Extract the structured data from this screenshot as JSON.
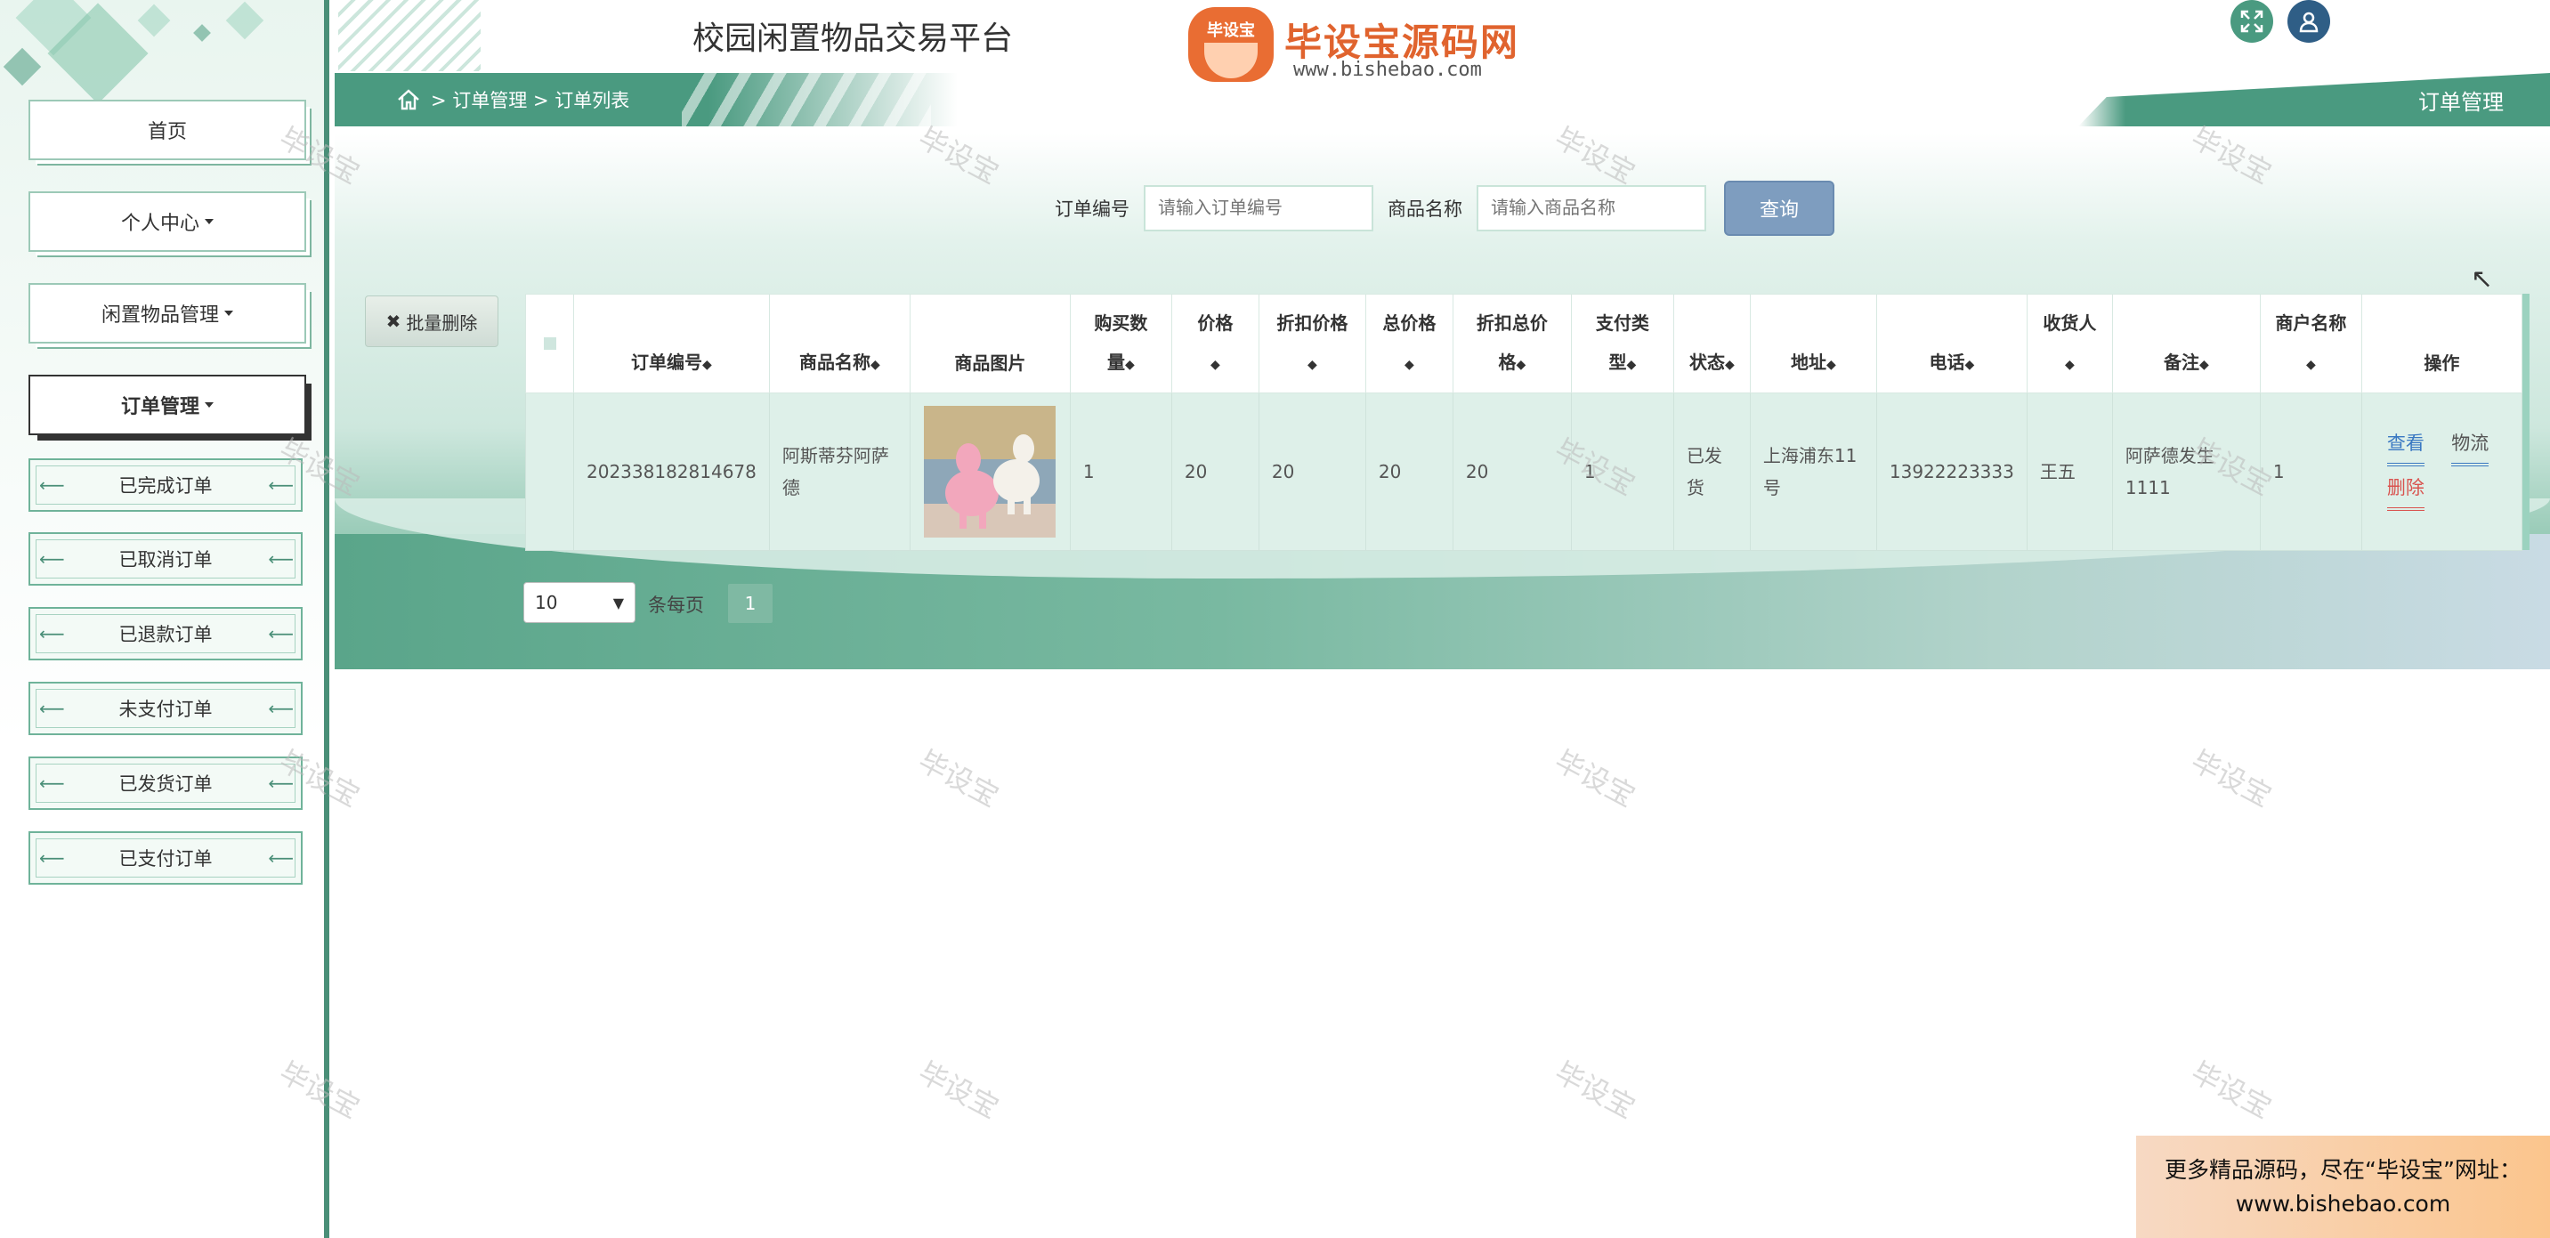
{
  "app": {
    "title": "校园闲置物品交易平台",
    "logo_main": "毕设宝源码网",
    "logo_badge": "毕设宝",
    "logo_url": "www.bishebao.com"
  },
  "header": {
    "fullscreen_icon": "expand-icon",
    "user_icon": "user-icon",
    "section_title": "订单管理"
  },
  "breadcrumb": {
    "home_icon": "home-icon",
    "text": "> 订单管理 > 订单列表"
  },
  "sidebar": {
    "items": [
      {
        "label": "首页"
      },
      {
        "label": "个人中心"
      },
      {
        "label": "闲置物品管理"
      },
      {
        "label": "订单管理"
      }
    ],
    "sub_items": [
      {
        "label": "已完成订单"
      },
      {
        "label": "已取消订单"
      },
      {
        "label": "已退款订单"
      },
      {
        "label": "未支付订单"
      },
      {
        "label": "已发货订单"
      },
      {
        "label": "已支付订单"
      }
    ]
  },
  "search": {
    "order_label": "订单编号",
    "order_placeholder": "请输入订单编号",
    "goods_label": "商品名称",
    "goods_placeholder": "请输入商品名称",
    "button": "查询"
  },
  "batch_delete": {
    "icon": "close-icon",
    "label": "批量删除"
  },
  "table": {
    "headers": {
      "order_no": "订单编号",
      "goods_name": "商品名称",
      "goods_img": "商品图片",
      "qty_1": "购买数",
      "qty_2": "量",
      "price": "价格",
      "discount_price": "折扣价格",
      "total": "总价格",
      "discount_total_1": "折扣总价",
      "discount_total_2": "格",
      "pay_type_1": "支付类",
      "pay_type_2": "型",
      "status": "状态",
      "address": "地址",
      "phone": "电话",
      "receiver": "收货人",
      "remark": "备注",
      "merchant": "商户名称",
      "ops": "操作"
    },
    "rows": [
      {
        "order_no": "202338182814678",
        "goods_name": "阿斯蒂芬阿萨德",
        "qty": "1",
        "price": "20",
        "discount_price": "20",
        "total": "20",
        "discount_total": "20",
        "pay_type": "1",
        "status": "已发货",
        "address": "上海浦东11号",
        "phone": "13922223333",
        "receiver": "王五",
        "remark": "阿萨德发生1111",
        "merchant": "1",
        "op_view": "查看",
        "op_logistics": "物流",
        "op_delete": "删除"
      }
    ]
  },
  "pagination": {
    "page_size": "10",
    "per_page_label": "条每页",
    "current_page": "1"
  },
  "watermark": "毕设宝",
  "ad": {
    "line1": "更多精品源码，尽在“毕设宝”网址：",
    "line2": "www.bishebao.com"
  },
  "colors": {
    "accent": "#4a9a80",
    "search_button": "#7e9dbf",
    "delete": "#d9534f",
    "link": "#3a78c2"
  }
}
